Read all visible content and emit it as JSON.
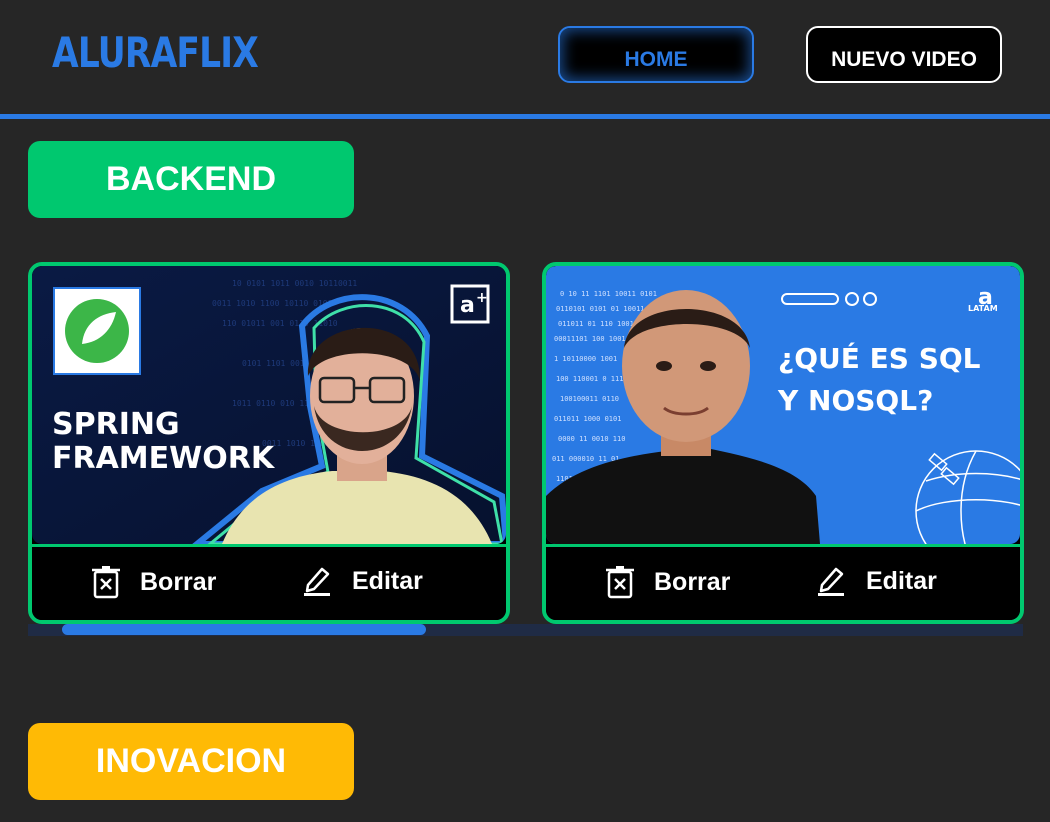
{
  "header": {
    "logo": "ALURAFLIX",
    "home_label": "HOME",
    "new_video_label": "NUEVO VIDEO"
  },
  "categories": [
    {
      "label": "BACKEND",
      "color": "#00c86f",
      "videos": [
        {
          "thumb_title_line1": "SPRING",
          "thumb_title_line2": "FRAMEWORK",
          "delete_label": "Borrar",
          "edit_label": "Editar"
        },
        {
          "thumb_title_line1": "¿QUÉ ES SQL",
          "thumb_title_line2": "Y NOSQL?",
          "thumb_brand": "LATAM",
          "delete_label": "Borrar",
          "edit_label": "Editar"
        }
      ]
    },
    {
      "label": "INOVACION",
      "color": "#ffba05"
    }
  ],
  "colors": {
    "accent": "#2a7ae4",
    "background": "#262626"
  }
}
